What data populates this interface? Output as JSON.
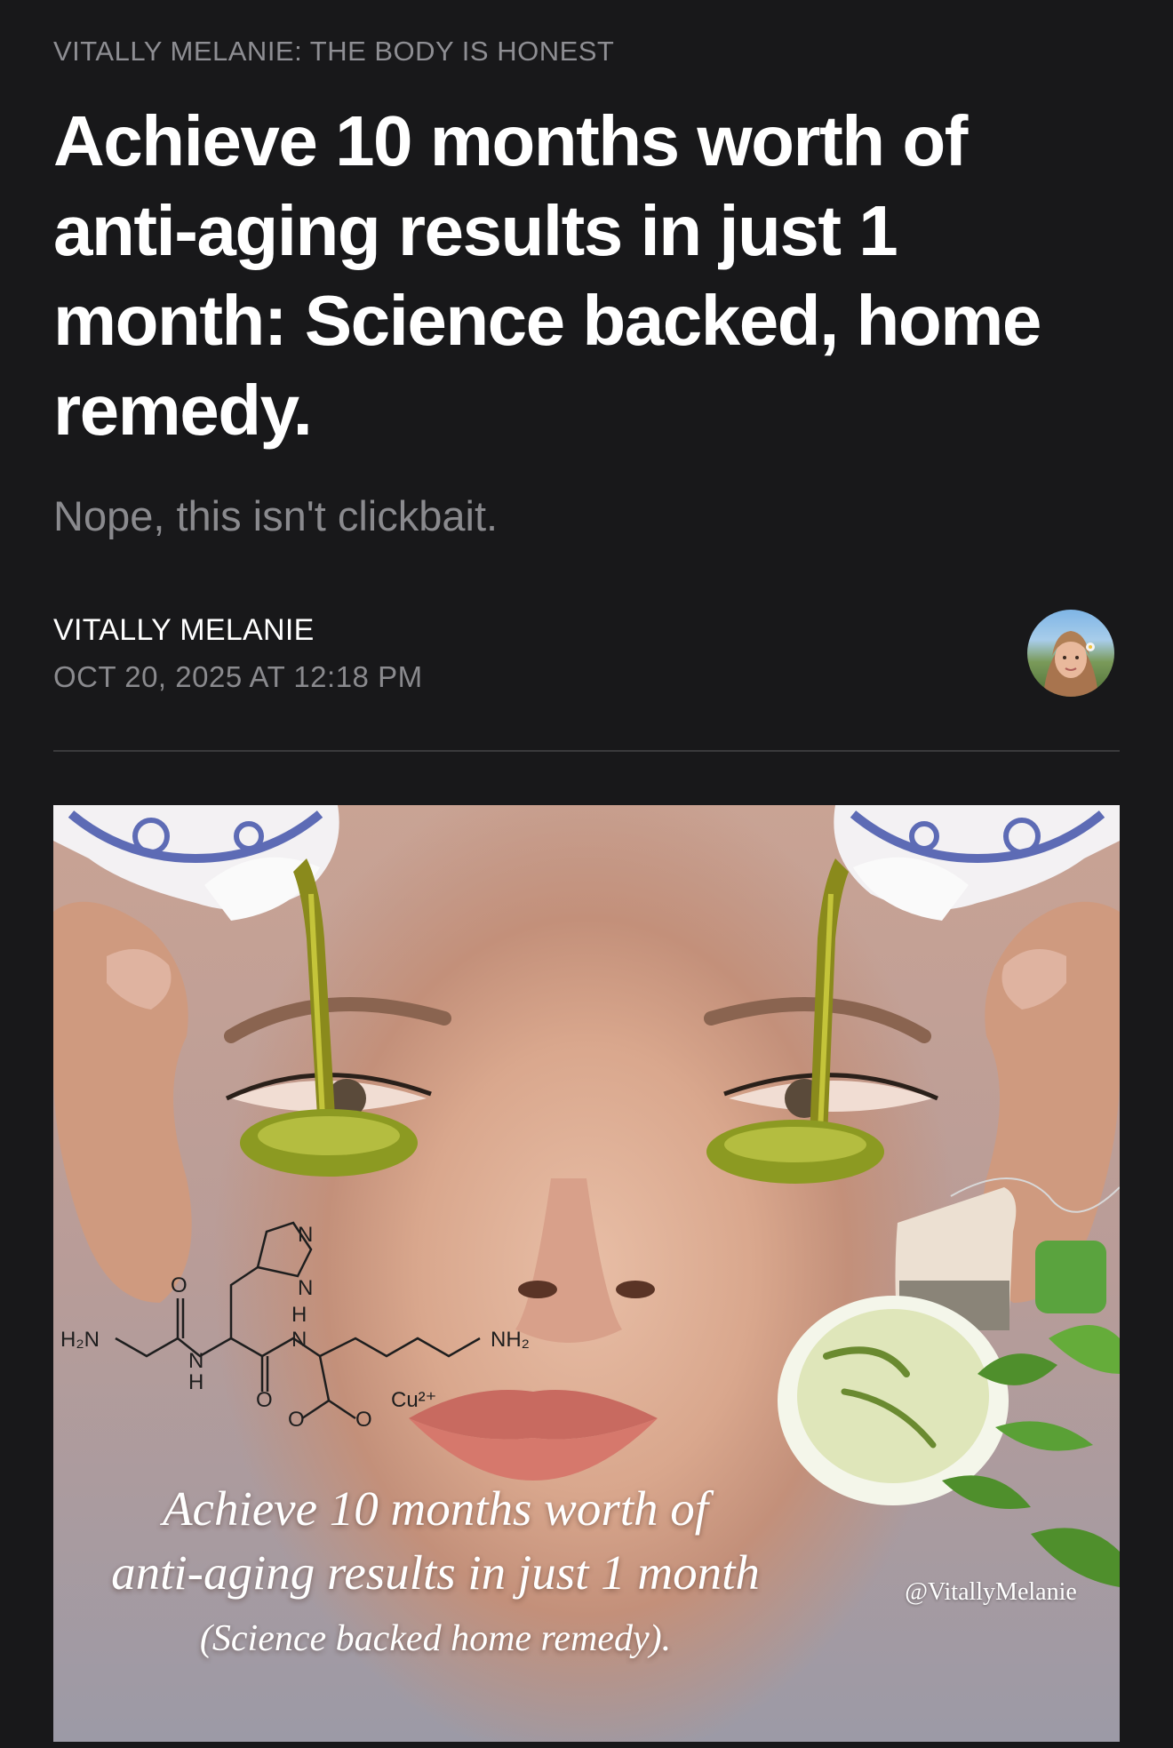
{
  "article": {
    "kicker": "VITALLY MELANIE: THE BODY IS HONEST",
    "headline": "Achieve 10 months worth of anti-aging results in just 1 month: Science backed, home remedy.",
    "subtitle": "Nope, this isn't clickbait.",
    "author": "VITALLY MELANIE",
    "date": "OCT 20, 2025 AT 12:18 PM"
  },
  "hero_image": {
    "overlay_line1": "Achieve 10 months worth of",
    "overlay_line2": "anti-aging results in just 1 month",
    "overlay_line3": "(Science backed home remedy).",
    "handle": "@VitallyMelanie",
    "chem_h2n": "H₂N",
    "chem_nh2": "NH₂",
    "chem_cu": "Cu²⁺",
    "chem_o1": "O",
    "chem_o2": "O",
    "chem_o3": "O",
    "chem_o4": "O",
    "chem_n1": "N",
    "chem_n2": "N",
    "chem_n3": "N",
    "chem_n4": "N",
    "chem_h1": "H",
    "chem_h2": "H"
  },
  "colors": {
    "background": "#18181a",
    "text_primary": "#ffffff",
    "text_secondary": "#8a8a8e",
    "divider": "#3a3a3c"
  }
}
